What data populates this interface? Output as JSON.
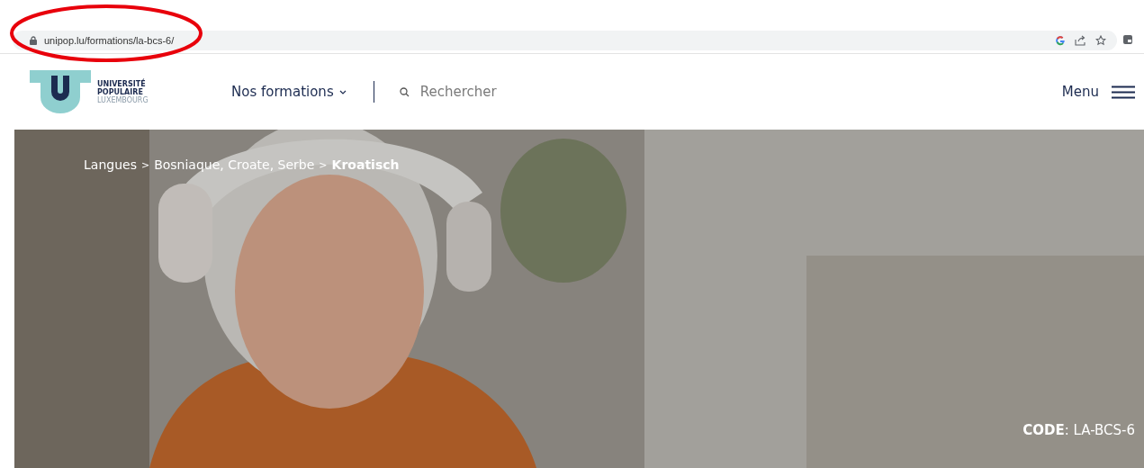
{
  "browser": {
    "url": "unipop.lu/formations/la-bcs-6/",
    "annotation": {
      "kind": "ellipse"
    }
  },
  "logo": {
    "lines": [
      "UNIVERSITÉ",
      "POPULAIRE",
      "LUXEMBOURG"
    ]
  },
  "nav": {
    "formations": "Nos formations",
    "search_placeholder": "Rechercher",
    "menu": "Menu"
  },
  "hero": {
    "breadcrumb": [
      {
        "label": "Langues",
        "kind": "link"
      },
      {
        "label": ">",
        "kind": "separator"
      },
      {
        "label": "Bosniaque, Croate, Serbe",
        "kind": "link"
      },
      {
        "label": ">",
        "kind": "separator"
      },
      {
        "label": "Kroatisch",
        "kind": "current"
      }
    ],
    "code": "**CODE**: LA-BCS-6"
  }
}
